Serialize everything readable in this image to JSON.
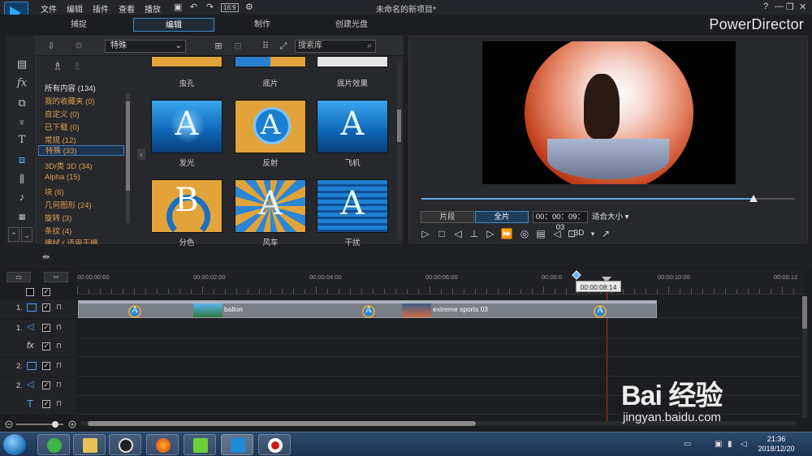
{
  "titlebar": {
    "menus": [
      "文件",
      "编辑",
      "插件",
      "查看",
      "播放"
    ],
    "project_title": "未命名的新项目*",
    "window_controls": [
      "?",
      "—",
      "❐",
      "✕"
    ],
    "ratio_label": "16:9"
  },
  "modes": {
    "tabs": [
      "捕捉",
      "编辑",
      "制作",
      "创建光盘"
    ],
    "active": "编辑",
    "brand": "PowerDirector"
  },
  "tools": [
    "media-room-icon",
    "fx-icon",
    "pip-icon",
    "particle-icon",
    "title-icon",
    "transition-icon",
    "audio-mix-icon",
    "voice-icon",
    "chapter-icon",
    "subtitle-icon"
  ],
  "library": {
    "category_select": "特殊",
    "search_placeholder": "搜索库",
    "categories": [
      {
        "label": "所有内容 (134)",
        "color": "white"
      },
      {
        "label": "我的收藏夹 (0)",
        "color": "orange"
      },
      {
        "label": "自定义 (0)",
        "color": "orange"
      },
      {
        "label": "已下载 (0)",
        "color": "orange"
      },
      {
        "label": "常规 (12)",
        "color": "orange"
      },
      {
        "label": "特殊 (33)",
        "color": "orange"
      },
      {
        "label": "3D/类 3D (34)",
        "color": "orange"
      },
      {
        "label": "Alpha (15)",
        "color": "orange"
      },
      {
        "label": "块 (6)",
        "color": "orange"
      },
      {
        "label": "几何图形 (24)",
        "color": "orange"
      },
      {
        "label": "旋转 (3)",
        "color": "orange"
      },
      {
        "label": "条纹 (4)",
        "color": "orange"
      },
      {
        "label": "擦拭 ( 适用于擦",
        "color": "orange"
      }
    ],
    "selected_category": "特殊 (33)",
    "thumbnails": [
      {
        "label": "虫孔"
      },
      {
        "label": "底片"
      },
      {
        "label": "底片效果"
      },
      {
        "label": "发光",
        "glyph": "A"
      },
      {
        "label": "反射",
        "glyph": "A"
      },
      {
        "label": "飞机",
        "glyph": "A"
      },
      {
        "label": "分色",
        "glyph": "B"
      },
      {
        "label": "风车",
        "glyph": "A"
      },
      {
        "label": "干扰",
        "glyph": "A"
      }
    ]
  },
  "preview": {
    "segment_label": "片段",
    "full_label": "全片",
    "timecode": "00：00：09：03",
    "fit_label": "适合大小",
    "mode_3d": "3D",
    "scrub_progress": 0.89
  },
  "timeline": {
    "ruler_labels": [
      "00:00:00:00",
      "00:00:02:00",
      "00:00:04:00",
      "00:00:06:00",
      "00:00:0",
      "00:00:10:00",
      "00:00:12"
    ],
    "playhead_time": "00:00:08:14",
    "tracks": [
      {
        "num": "1.",
        "kind": "video"
      },
      {
        "num": "1.",
        "kind": "audio"
      },
      {
        "num": "",
        "kind": "fx",
        "label": "fx"
      },
      {
        "num": "2.",
        "kind": "video"
      },
      {
        "num": "2.",
        "kind": "audio"
      },
      {
        "num": "",
        "kind": "title",
        "label": "T"
      }
    ],
    "clips": [
      {
        "name": "ballon"
      },
      {
        "name": "extreme sports 03"
      }
    ],
    "check_mark": "✓",
    "lock_glyph": "🔒"
  },
  "taskbar": {
    "time": "21:36",
    "date": "2018/12/20",
    "apps": [
      "ie-icon",
      "explorer-icon",
      "qq-icon",
      "firefox-icon",
      "media-player-icon",
      "powerdirector-icon",
      "recorder-icon"
    ]
  },
  "watermark": {
    "logo": "Bai 经验",
    "url": "jingyan.baidu.com"
  }
}
